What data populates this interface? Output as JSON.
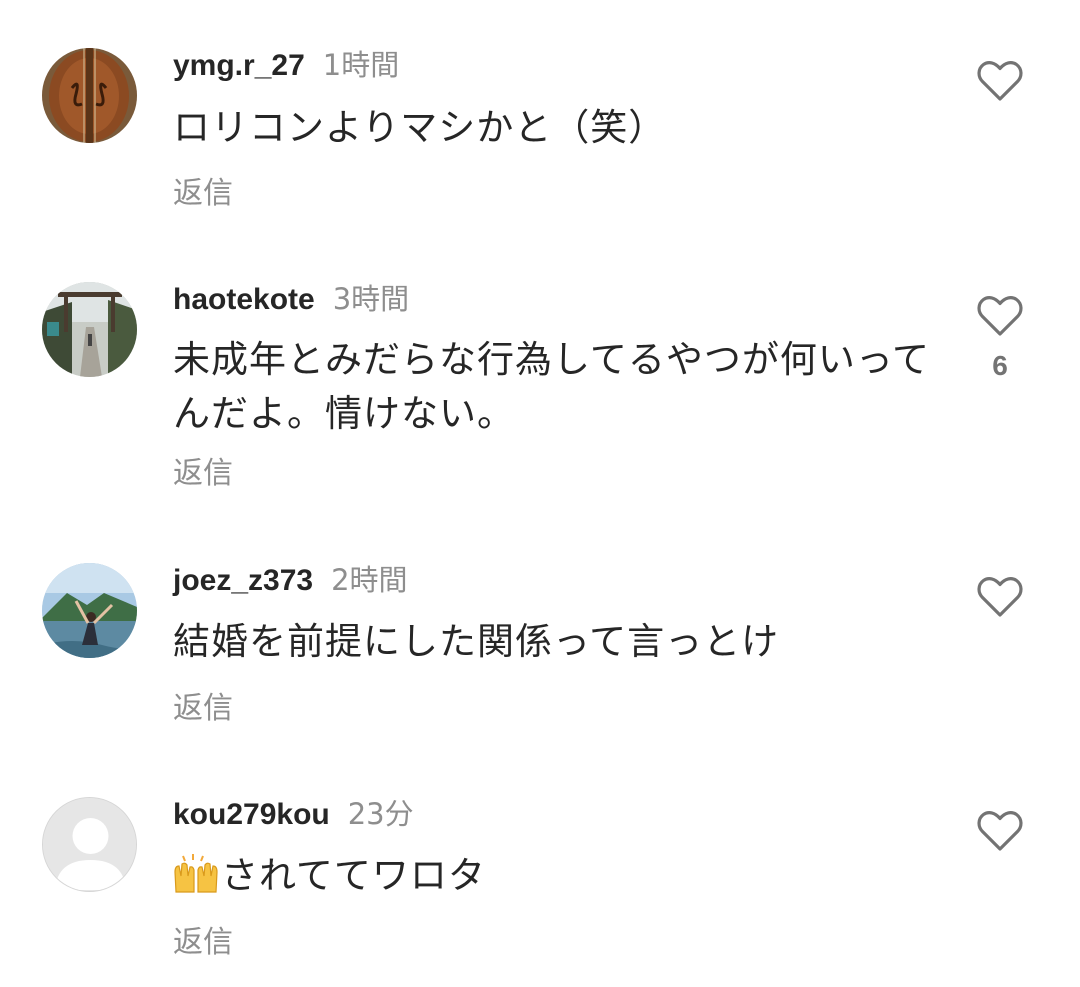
{
  "reply_label": "返信",
  "comments": [
    {
      "username": "ymg.r_27",
      "time": "1時間",
      "text": "ロリコンよりマシかと（笑）",
      "like_count": "",
      "avatar_icon": "violin-avatar"
    },
    {
      "username": "haotekote",
      "time": "3時間",
      "text": "未成年とみだらな行為してるやつが何いってんだよ。情けない。",
      "like_count": "6",
      "avatar_icon": "shrine-path-avatar"
    },
    {
      "username": "joez_z373",
      "time": "2時間",
      "text": "結婚を前提にした関係って言っとけ",
      "like_count": "",
      "avatar_icon": "person-by-water-avatar"
    },
    {
      "username": "kou279kou",
      "time": "23分",
      "text_emoji": "raising-hands-emoji",
      "text": "されててワロタ",
      "like_count": "",
      "avatar_icon": "default-user-avatar"
    }
  ],
  "colors": {
    "text": "#262626",
    "secondary": "#8e8e8e",
    "icon": "#737373",
    "background": "#ffffff"
  }
}
